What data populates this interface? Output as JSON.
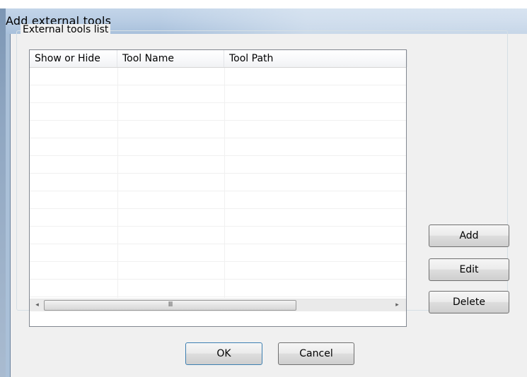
{
  "dialog": {
    "title": "Add external tools"
  },
  "group": {
    "label": "External tools list"
  },
  "list": {
    "columns": [
      "Show or Hide",
      "Tool Name",
      "Tool Path"
    ],
    "rows": []
  },
  "scrollbar": {
    "left_arrow": "◂",
    "right_arrow": "▸",
    "thumb_grip": "III"
  },
  "buttons": {
    "add": "Add",
    "edit": "Edit",
    "delete": "Delete",
    "ok": "OK",
    "cancel": "Cancel"
  },
  "colors": {
    "titlebar": "#b9cde4",
    "dialog_background": "#f0f0f0",
    "list_border": "#828790",
    "default_button_border": "#3c7fb1"
  }
}
